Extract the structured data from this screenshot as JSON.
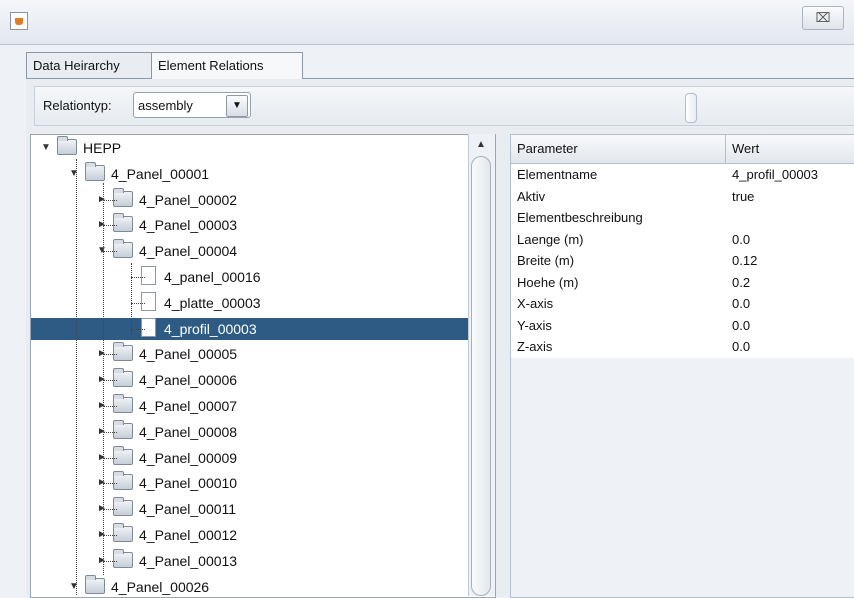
{
  "window": {
    "close_glyph": "⌧"
  },
  "tabs": [
    {
      "label": "Data Heirarchy",
      "active": false
    },
    {
      "label": "Element Relations",
      "active": true
    }
  ],
  "toolbar": {
    "relation_label": "Relationtyp:",
    "relation_value": "assembly",
    "dropdown_glyph": "▼"
  },
  "tree": {
    "nodes": [
      {
        "label": "HEPP",
        "depth": 0,
        "type": "folder",
        "expanded": true,
        "selected": false
      },
      {
        "label": "4_Panel_00001",
        "depth": 1,
        "type": "folder",
        "expanded": true,
        "selected": false
      },
      {
        "label": "4_Panel_00002",
        "depth": 2,
        "type": "folder",
        "expanded": false,
        "selected": false
      },
      {
        "label": "4_Panel_00003",
        "depth": 2,
        "type": "folder",
        "expanded": false,
        "selected": false
      },
      {
        "label": "4_Panel_00004",
        "depth": 2,
        "type": "folder",
        "expanded": true,
        "selected": false
      },
      {
        "label": "4_panel_00016",
        "depth": 3,
        "type": "file",
        "expanded": null,
        "selected": false
      },
      {
        "label": "4_platte_00003",
        "depth": 3,
        "type": "file",
        "expanded": null,
        "selected": false
      },
      {
        "label": "4_profil_00003",
        "depth": 3,
        "type": "file",
        "expanded": null,
        "selected": true
      },
      {
        "label": "4_Panel_00005",
        "depth": 2,
        "type": "folder",
        "expanded": false,
        "selected": false
      },
      {
        "label": "4_Panel_00006",
        "depth": 2,
        "type": "folder",
        "expanded": false,
        "selected": false
      },
      {
        "label": "4_Panel_00007",
        "depth": 2,
        "type": "folder",
        "expanded": false,
        "selected": false
      },
      {
        "label": "4_Panel_00008",
        "depth": 2,
        "type": "folder",
        "expanded": false,
        "selected": false
      },
      {
        "label": "4_Panel_00009",
        "depth": 2,
        "type": "folder",
        "expanded": false,
        "selected": false
      },
      {
        "label": "4_Panel_00010",
        "depth": 2,
        "type": "folder",
        "expanded": false,
        "selected": false
      },
      {
        "label": "4_Panel_00011",
        "depth": 2,
        "type": "folder",
        "expanded": false,
        "selected": false
      },
      {
        "label": "4_Panel_00012",
        "depth": 2,
        "type": "folder",
        "expanded": false,
        "selected": false
      },
      {
        "label": "4_Panel_00013",
        "depth": 2,
        "type": "folder",
        "expanded": false,
        "selected": false
      },
      {
        "label": "4_Panel_00026",
        "depth": 1,
        "type": "folder",
        "expanded": true,
        "selected": false
      }
    ],
    "scroll_up_glyph": "▲"
  },
  "properties": {
    "headers": [
      "Parameter",
      "Wert"
    ],
    "rows": [
      [
        "Elementname",
        "4_profil_00003"
      ],
      [
        "Aktiv",
        "true"
      ],
      [
        "Elementbeschreibung",
        ""
      ],
      [
        "Laenge (m)",
        "0.0"
      ],
      [
        "Breite (m)",
        "0.12"
      ],
      [
        "Hoehe (m)",
        "0.2"
      ],
      [
        "X-axis",
        "0.0"
      ],
      [
        "Y-axis",
        "0.0"
      ],
      [
        "Z-axis",
        "0.0"
      ]
    ]
  },
  "colors": {
    "selection": "#2e5b84"
  }
}
